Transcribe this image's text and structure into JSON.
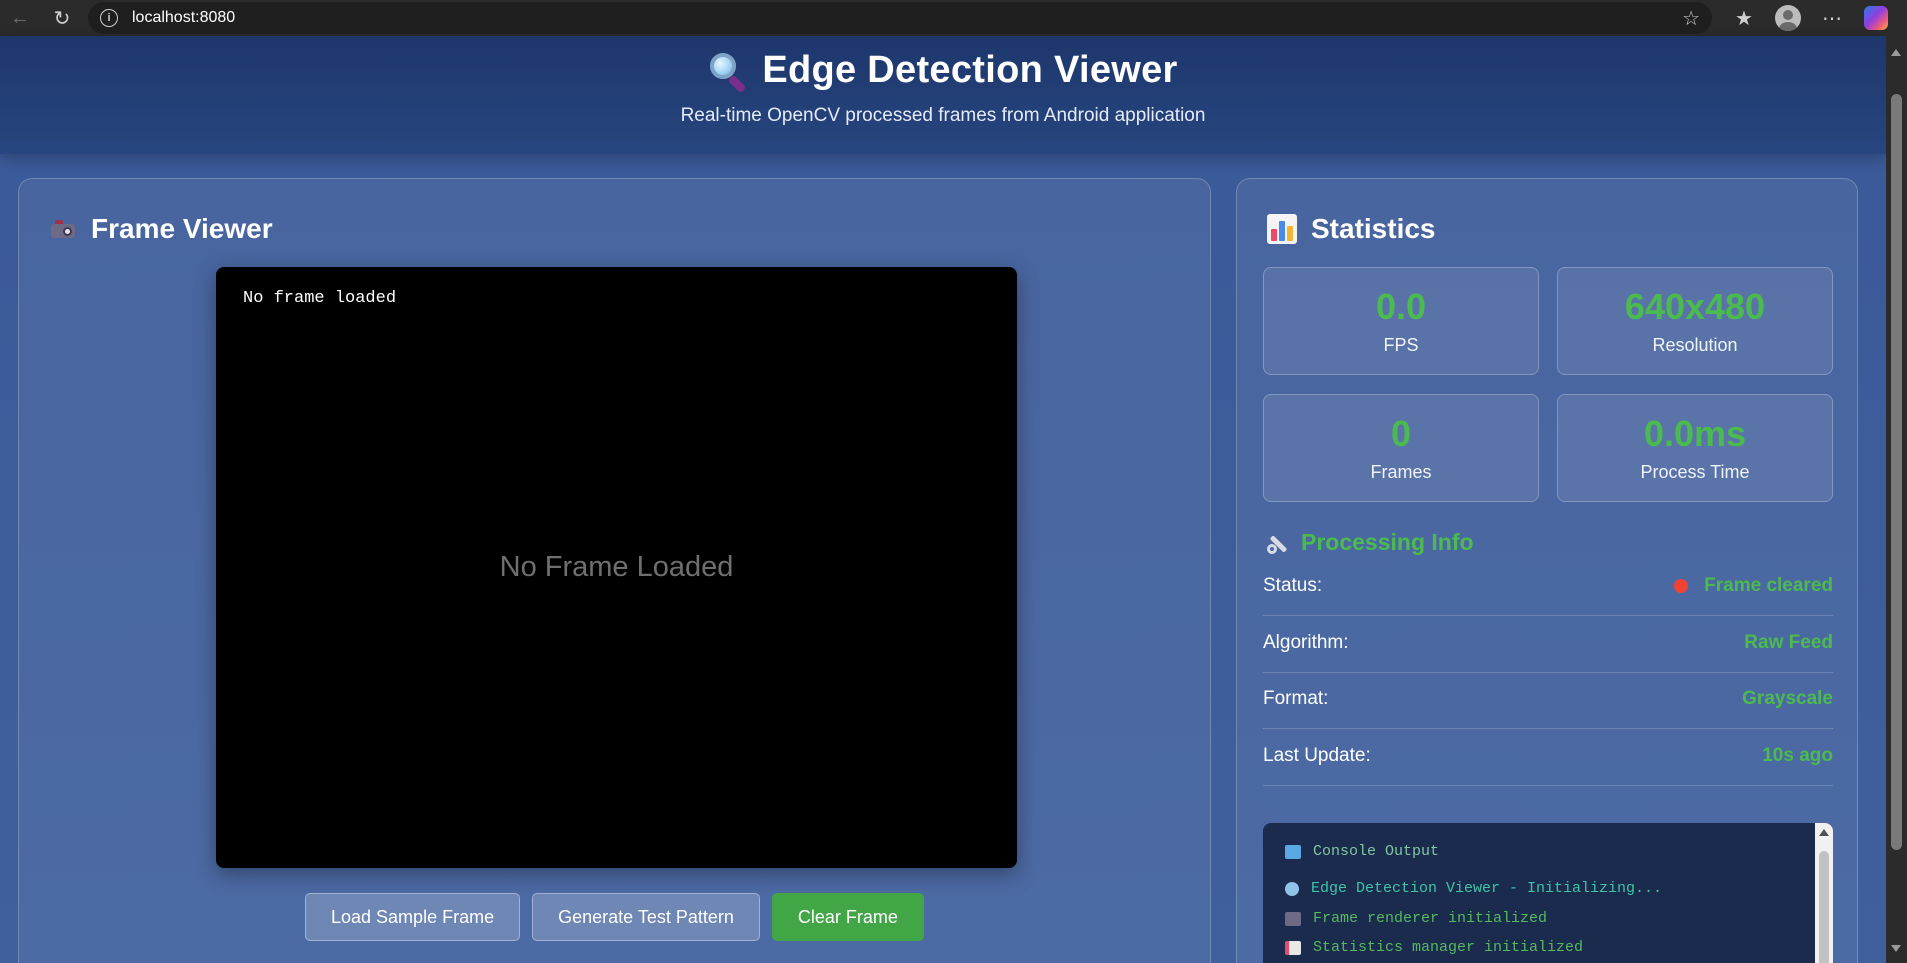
{
  "browser": {
    "url": "localhost:8080"
  },
  "header": {
    "title": "Edge Detection Viewer",
    "subtitle": "Real-time OpenCV processed frames from Android application"
  },
  "frame_viewer": {
    "title": "Frame Viewer",
    "overlay_text": "No frame loaded",
    "placeholder_text": "No Frame Loaded",
    "buttons": {
      "load_sample": "Load Sample Frame",
      "generate_test": "Generate Test Pattern",
      "clear": "Clear Frame"
    }
  },
  "statistics": {
    "title": "Statistics",
    "stats": [
      {
        "value": "0.0",
        "label": "FPS"
      },
      {
        "value": "640x480",
        "label": "Resolution"
      },
      {
        "value": "0",
        "label": "Frames"
      },
      {
        "value": "0.0ms",
        "label": "Process Time"
      }
    ],
    "processing_info": {
      "title": "Processing Info",
      "rows": [
        {
          "key": "Status:",
          "value": "Frame cleared"
        },
        {
          "key": "Algorithm:",
          "value": "Raw Feed"
        },
        {
          "key": "Format:",
          "value": "Grayscale"
        },
        {
          "key": "Last Update:",
          "value": "10s ago"
        }
      ]
    },
    "console": {
      "title": "Console Output",
      "lines": [
        "Edge Detection Viewer - Initializing...",
        "Frame renderer initialized",
        "Statistics manager initialized"
      ]
    }
  },
  "colors": {
    "accent_green": "#4cbb4f",
    "status_red": "#f24236",
    "header_bg": "#1d376c",
    "page_bg": "#3c5a96"
  }
}
